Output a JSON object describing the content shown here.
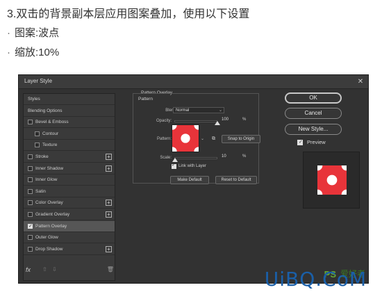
{
  "instructions": {
    "title": "3.双击的背景副本层应用图案叠加，使用以下设置",
    "item1": "图案:波点",
    "item2": "缩放:10%",
    "bullet": "·"
  },
  "dialog": {
    "title": "Layer Style",
    "close_glyph": "✕",
    "styles": [
      {
        "label": "Styles",
        "checkbox": false,
        "checked": false,
        "plus": false,
        "indent": 0
      },
      {
        "label": "Blending Options",
        "checkbox": false,
        "checked": false,
        "plus": false,
        "indent": 0
      },
      {
        "label": "Bevel & Emboss",
        "checkbox": true,
        "checked": false,
        "plus": false,
        "indent": 0
      },
      {
        "label": "Contour",
        "checkbox": true,
        "checked": false,
        "plus": false,
        "indent": 1
      },
      {
        "label": "Texture",
        "checkbox": true,
        "checked": false,
        "plus": false,
        "indent": 1
      },
      {
        "label": "Stroke",
        "checkbox": true,
        "checked": false,
        "plus": true,
        "indent": 0
      },
      {
        "label": "Inner Shadow",
        "checkbox": true,
        "checked": false,
        "plus": true,
        "indent": 0
      },
      {
        "label": "Inner Glow",
        "checkbox": true,
        "checked": false,
        "plus": false,
        "indent": 0
      },
      {
        "label": "Satin",
        "checkbox": true,
        "checked": false,
        "plus": false,
        "indent": 0
      },
      {
        "label": "Color Overlay",
        "checkbox": true,
        "checked": false,
        "plus": true,
        "indent": 0
      },
      {
        "label": "Gradient Overlay",
        "checkbox": true,
        "checked": false,
        "plus": true,
        "indent": 0
      },
      {
        "label": "Pattern Overlay",
        "checkbox": true,
        "checked": true,
        "plus": false,
        "indent": 0,
        "selected": true
      },
      {
        "label": "Outer Glow",
        "checkbox": true,
        "checked": false,
        "plus": false,
        "indent": 0
      },
      {
        "label": "Drop Shadow",
        "checkbox": true,
        "checked": false,
        "plus": true,
        "indent": 0
      }
    ],
    "bottom_icons": {
      "fx": "fx",
      "up": "⇧",
      "down": "⇩",
      "trash": "🗑"
    },
    "panel": {
      "group_title": "Pattern Overlay",
      "subgroup_title": "Pattern",
      "blend_mode_label": "Blend Mode:",
      "blend_mode_value": "Normal",
      "opacity_label": "Opacity:",
      "opacity_value": "100",
      "opacity_unit": "%",
      "opacity_fraction": 1.0,
      "pattern_label": "Pattern:",
      "snap_button": "Snap to Origin",
      "scale_label": "Scale:",
      "scale_value": "10",
      "scale_unit": "%",
      "scale_fraction": 0.02,
      "link_label": "Link with Layer",
      "link_checked": true,
      "make_default": "Make Default",
      "reset_default": "Reset to Default"
    },
    "buttons": {
      "ok": "OK",
      "cancel": "Cancel",
      "new_style": "New Style...",
      "preview_label": "Preview",
      "preview_checked": true
    },
    "colors": {
      "pattern_red": "#e8343a",
      "dot_white": "#ffffff"
    }
  },
  "watermark": {
    "ps": "PS",
    "cn": "爱好者",
    "brand": "UiBQ.CoM"
  }
}
